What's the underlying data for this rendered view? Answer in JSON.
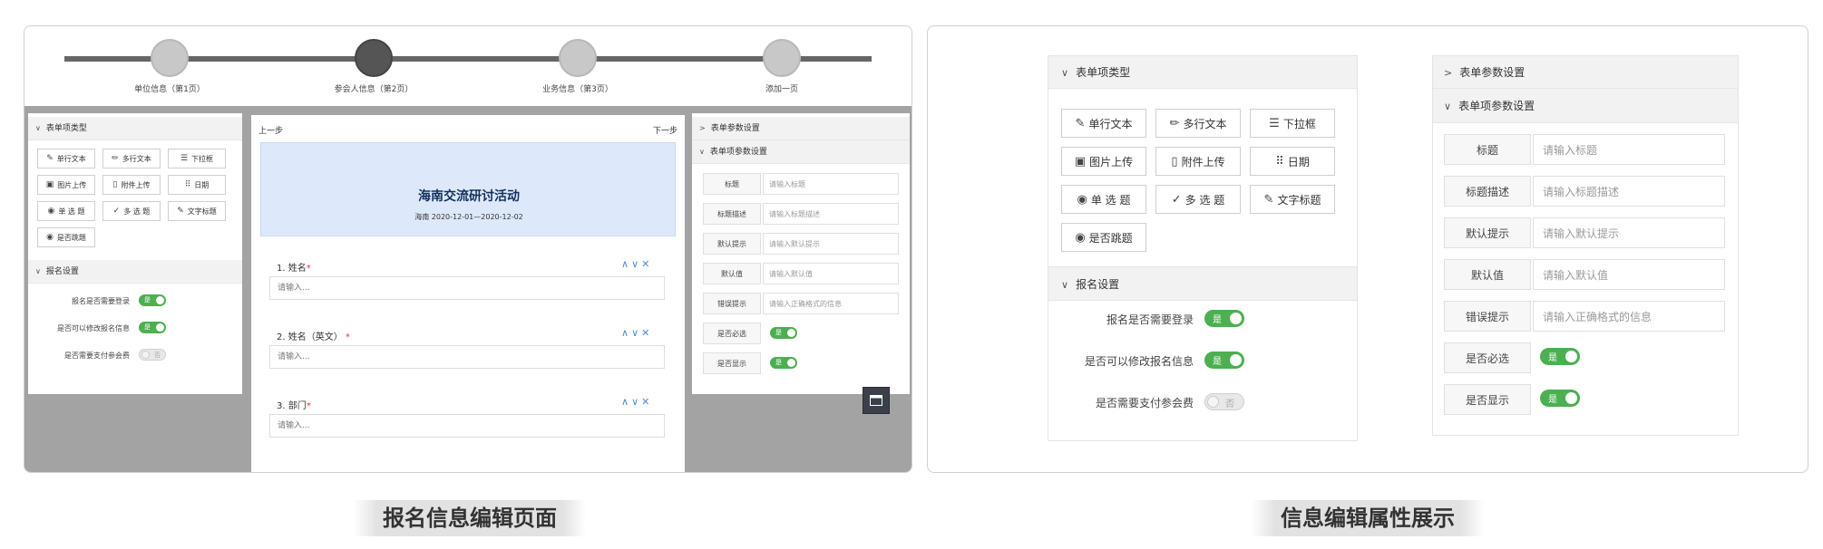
{
  "left": {
    "steps": [
      {
        "label": "单位信息（第1页）",
        "active": false
      },
      {
        "label": "参会人信息（第2页）",
        "active": true
      },
      {
        "label": "业务信息（第3页）",
        "active": false
      },
      {
        "label": "添加一页",
        "active": false
      }
    ],
    "form_types": {
      "header": "表单项类型",
      "items": [
        {
          "label": "单行文本",
          "icon": "edit-doc-icon"
        },
        {
          "label": "多行文本",
          "icon": "pencil-icon"
        },
        {
          "label": "下拉框",
          "icon": "list-circle-icon"
        },
        {
          "label": "图片上传",
          "icon": "image-icon"
        },
        {
          "label": "附件上传",
          "icon": "file-icon"
        },
        {
          "label": "日期",
          "icon": "calendar-grid-icon"
        },
        {
          "label": "单 选 题",
          "icon": "radio-icon"
        },
        {
          "label": "多 选 题",
          "icon": "check-icon"
        },
        {
          "label": "文字标题",
          "icon": "title-doc-icon"
        },
        {
          "label": "是否跳题",
          "icon": "radio-icon"
        }
      ]
    },
    "signup_settings": {
      "header": "报名设置",
      "rows": [
        {
          "label": "报名是否需要登录",
          "state": "是",
          "on": true
        },
        {
          "label": "是否可以修改报名信息",
          "state": "是",
          "on": true
        },
        {
          "label": "是否需要支付参会费",
          "state": "否",
          "on": false
        }
      ]
    },
    "form": {
      "prev": "上一步",
      "next": "下一步",
      "title": "海南交流研讨活动",
      "subtitle": "海南 2020-12-01—2020-12-02",
      "questions": [
        {
          "label": "1. 姓名",
          "placeholder": "请输入..."
        },
        {
          "label": "2. 姓名（英文）",
          "placeholder": "请输入..."
        },
        {
          "label": "3. 部门",
          "placeholder": "请输入..."
        }
      ]
    },
    "params": {
      "section1": "表单参数设置",
      "section2": "表单项参数设置",
      "rows": [
        {
          "label": "标题",
          "value": "请输入标题"
        },
        {
          "label": "标题描述",
          "value": "请输入标题描述"
        },
        {
          "label": "默认提示",
          "value": "请输入默认提示"
        },
        {
          "label": "默认值",
          "value": "请输入默认值"
        },
        {
          "label": "错误提示",
          "value": "请输入正确格式的信息"
        }
      ],
      "toggles": [
        {
          "label": "是否必选",
          "state": "是"
        },
        {
          "label": "是否显示",
          "state": "是"
        }
      ]
    }
  },
  "right": {
    "form_types": {
      "header": "表单项类型",
      "items": [
        {
          "label": "单行文本",
          "icon": "edit-doc-icon"
        },
        {
          "label": "多行文本",
          "icon": "pencil-icon"
        },
        {
          "label": "下拉框",
          "icon": "list-circle-icon"
        },
        {
          "label": "图片上传",
          "icon": "image-icon"
        },
        {
          "label": "附件上传",
          "icon": "file-icon"
        },
        {
          "label": "日期",
          "icon": "calendar-grid-icon"
        },
        {
          "label": "单 选 题",
          "icon": "radio-icon"
        },
        {
          "label": "多 选 题",
          "icon": "check-icon"
        },
        {
          "label": "文字标题",
          "icon": "title-doc-icon"
        },
        {
          "label": "是否跳题",
          "icon": "radio-icon"
        }
      ]
    },
    "signup_settings": {
      "header": "报名设置",
      "rows": [
        {
          "label": "报名是否需要登录",
          "state": "是",
          "on": true
        },
        {
          "label": "是否可以修改报名信息",
          "state": "是",
          "on": true
        },
        {
          "label": "是否需要支付参会费",
          "state": "否",
          "on": false
        }
      ]
    },
    "params": {
      "section1": "表单参数设置",
      "section2": "表单项参数设置",
      "rows": [
        {
          "label": "标题",
          "value": "请输入标题"
        },
        {
          "label": "标题描述",
          "value": "请输入标题描述"
        },
        {
          "label": "默认提示",
          "value": "请输入默认提示"
        },
        {
          "label": "默认值",
          "value": "请输入默认值"
        },
        {
          "label": "错误提示",
          "value": "请输入正确格式的信息"
        }
      ],
      "toggles": [
        {
          "label": "是否必选",
          "state": "是"
        },
        {
          "label": "是否显示",
          "state": "是"
        }
      ]
    }
  },
  "captions": {
    "left": "报名信息编辑页面",
    "right": "信息编辑属性展示"
  }
}
